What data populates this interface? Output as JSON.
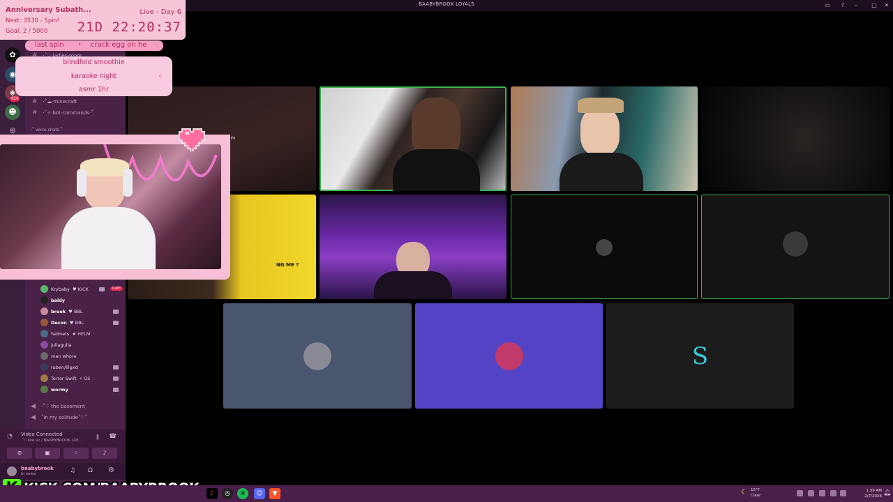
{
  "window": {
    "title": "BAABYBROOK LOYALS"
  },
  "overlay": {
    "event_title": "Anniversary Subath...",
    "next": "Next: 3530 - Spin!",
    "goal": "Goal: 2 / 5000",
    "day": "Live - Day 6",
    "countdown": "21D 22:20:37",
    "last_spin_label": "last spin",
    "last_spin_value": "crack egg on he",
    "spin_options": [
      "blindfold smoothie",
      "karaoke night",
      "asmr 1hr"
    ]
  },
  "sidebar": {
    "rail_badge": "424",
    "channels": [
      {
        "name": "·˚♡·ladies-room"
      },
      {
        "name": "·˚☁·minecraft"
      },
      {
        "name": "·˚✧·bot-commands·˚"
      }
    ],
    "category": "·˚ voice chats ˚",
    "live_channel_fragment": "eam",
    "members": [
      {
        "name": "Krybaby",
        "tag": "♥ KICK",
        "live": "LIVE",
        "bold": false
      },
      {
        "name": "baldy",
        "tag": "",
        "bold": true
      },
      {
        "name": "brook",
        "tag": "♥ BBL",
        "bold": true
      },
      {
        "name": "Decon",
        "tag": "♥ BBL",
        "bold": true
      },
      {
        "name": "helmets",
        "tag": "★ HELM",
        "bold": false
      },
      {
        "name": "juliagulla",
        "tag": "",
        "bold": false
      },
      {
        "name": "man whore",
        "tag": "",
        "bold": false
      },
      {
        "name": "ruben/lilgxd",
        "tag": "",
        "bold": false
      },
      {
        "name": "Terror Swift",
        "tag": "⚡ GS",
        "bold": false
      },
      {
        "name": "wormy",
        "tag": "",
        "bold": true
      }
    ],
    "voice_channels": [
      {
        "name": "·˚♡ the basement"
      },
      {
        "name": "˚in my solitude˚♡˚"
      }
    ],
    "voice_status": "Video Connected",
    "voice_channel_path": "˚♡live vc / BAABYBROOK LOY...",
    "user": {
      "name": "baabybrook",
      "status": "In voice"
    }
  },
  "tiles": {
    "video_label": "Stream"
  },
  "brand": {
    "kick_letter": "K",
    "kick_url": "KICK.COM/BAABYBROOK"
  },
  "taskbar": {
    "weather_temp": "15°F",
    "weather_cond": "Clear",
    "time": "1:39 AM",
    "date": "2/7/2026"
  },
  "colors": {
    "speaking_outline": "#3bb34e",
    "overlay_pink": "#f6c6d8",
    "overlay_text": "#b42a5f",
    "kick_green": "#53fc18",
    "blurple_tile": "#5543c6",
    "slate_tile": "#4a556e"
  }
}
